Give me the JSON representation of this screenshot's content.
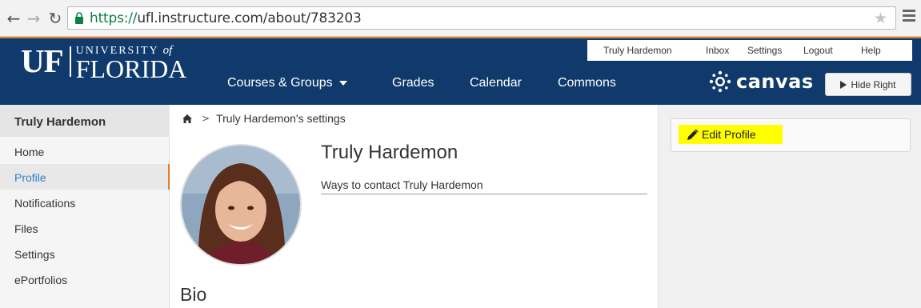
{
  "browser": {
    "url_scheme": "https://",
    "url_rest": "ufl.instructure.com/about/783203"
  },
  "header": {
    "logo_uf": "UF",
    "logo_university": "UNIVERSITY",
    "logo_of": "of",
    "logo_florida": "FLORIDA",
    "utility_nav": [
      "Truly Hardemon",
      "Inbox",
      "Settings",
      "Logout",
      "Help"
    ],
    "main_nav": {
      "courses": "Courses & Groups",
      "grades": "Grades",
      "calendar": "Calendar",
      "commons": "Commons"
    },
    "brand": "canvas",
    "hide_right_label": "Hide Right",
    "colors": {
      "header_bg": "#103a6b",
      "accent": "#e87722"
    }
  },
  "sidebar": {
    "title": "Truly Hardemon",
    "items": [
      {
        "label": "Home",
        "active": false
      },
      {
        "label": "Profile",
        "active": true
      },
      {
        "label": "Notifications",
        "active": false
      },
      {
        "label": "Files",
        "active": false
      },
      {
        "label": "Settings",
        "active": false
      },
      {
        "label": "ePortfolios",
        "active": false
      }
    ]
  },
  "main": {
    "breadcrumb": "Truly Hardemon's settings",
    "profile_name": "Truly Hardemon",
    "contact_text": "Ways to contact Truly Hardemon",
    "bio_heading": "Bio"
  },
  "right": {
    "edit_profile_label": "Edit Profile",
    "highlight_color": "#ffff00"
  }
}
